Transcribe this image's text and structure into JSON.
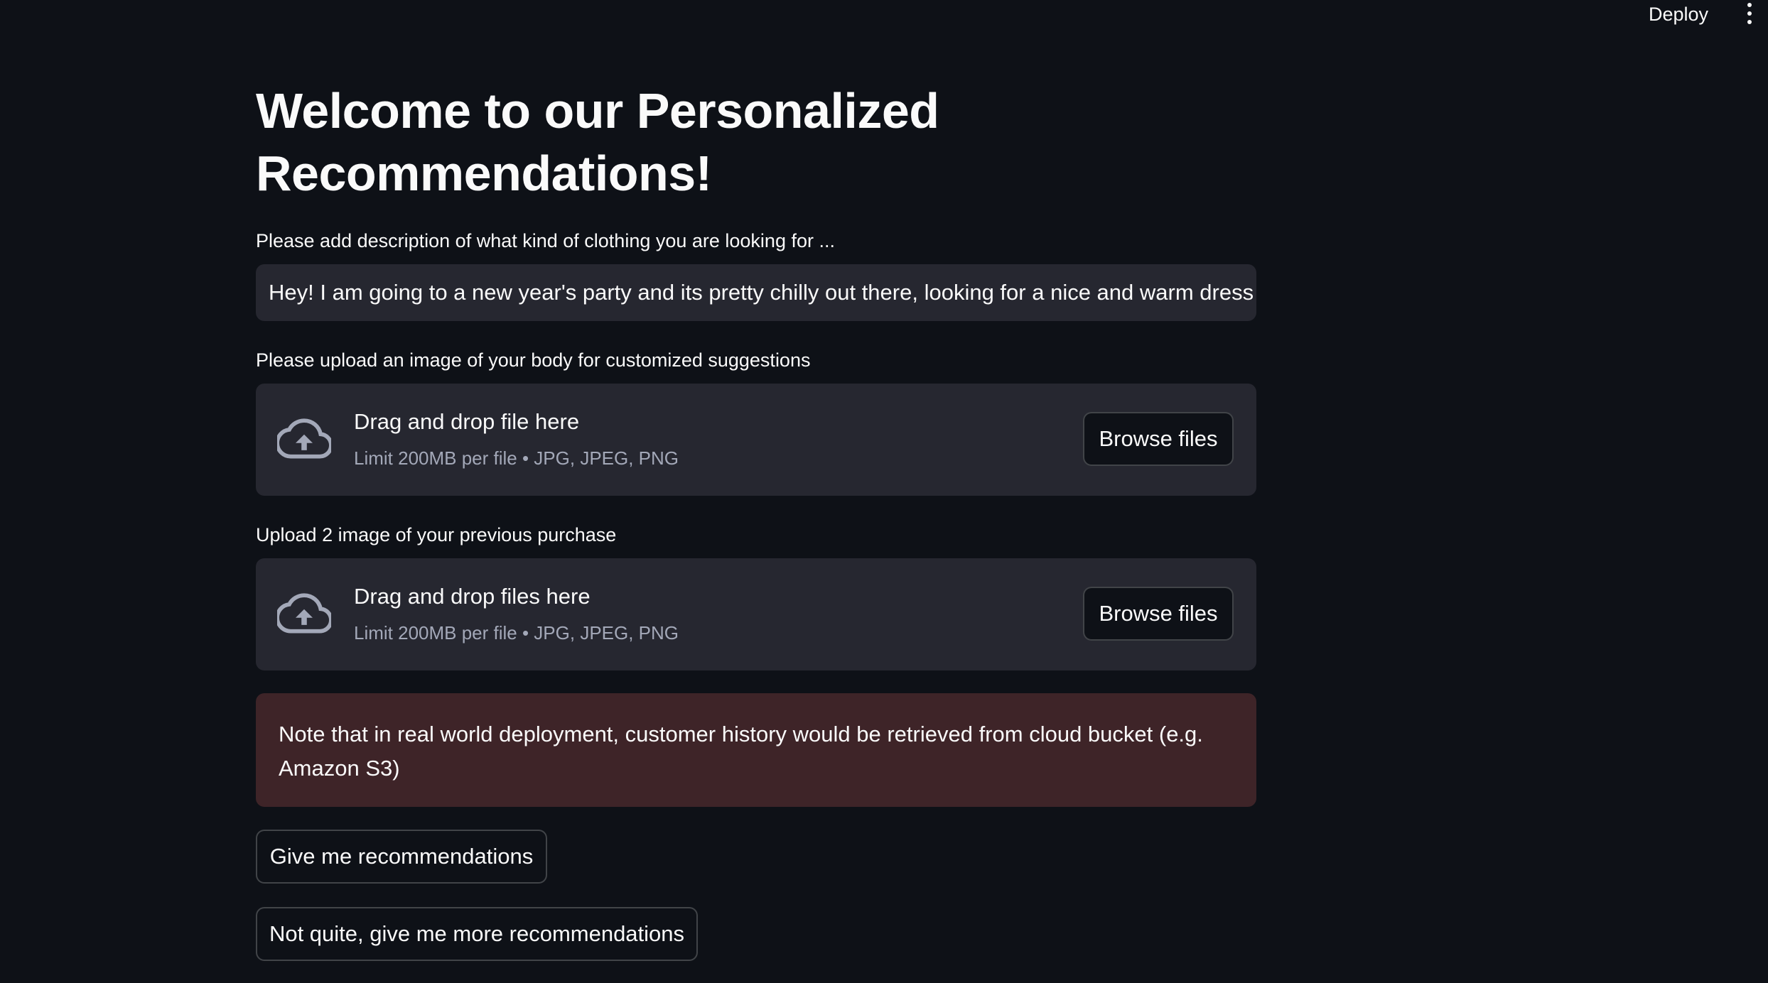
{
  "header": {
    "deploy_label": "Deploy",
    "menu_icon": "kebab-menu-icon"
  },
  "main": {
    "title": "Welcome to our Personalized Recommendations!",
    "description": {
      "label": "Please add description of what kind of clothing you are looking for ...",
      "value": "Hey! I am going to a new year's party and its pretty chilly out there, looking for a nice and warm dress"
    },
    "body_upload": {
      "label": "Please upload an image of your body for customized suggestions",
      "drop_text": "Drag and drop file here",
      "limit_text": "Limit 200MB per file • JPG, JPEG, PNG",
      "browse_label": "Browse files",
      "icon": "cloud-upload-icon"
    },
    "purchase_upload": {
      "label": "Upload 2 image of your previous purchase",
      "drop_text": "Drag and drop files here",
      "limit_text": "Limit 200MB per file • JPG, JPEG, PNG",
      "browse_label": "Browse files",
      "icon": "cloud-upload-icon"
    },
    "note": "Note that in real world deployment, customer history would be retrieved from cloud bucket (e.g. Amazon S3)",
    "buttons": {
      "recommend": "Give me recommendations",
      "more": "Not quite, give me more recommendations"
    }
  },
  "colors": {
    "background": "#0e1117",
    "input_bg": "#262730",
    "note_bg": "#3e2428",
    "text": "#fafafa",
    "muted_text": "#a3a8b8"
  }
}
